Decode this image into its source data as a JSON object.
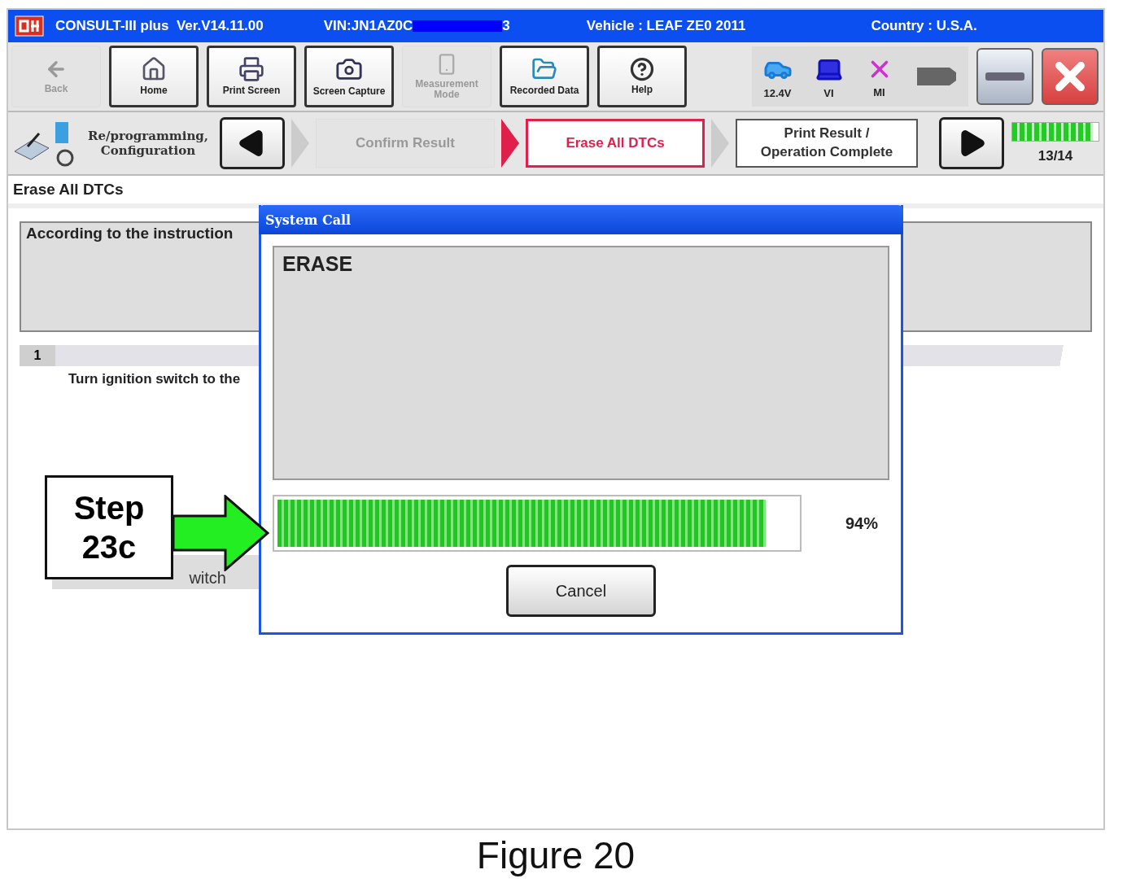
{
  "window": {
    "title": "CONSULT-III plus  Ver.V14.11.00",
    "vin_prefix": "VIN:JN1AZ0C",
    "vin_suffix": "3",
    "vehicle": "Vehicle : LEAF ZE0 2011",
    "country": "Country : U.S.A."
  },
  "toolbar": [
    {
      "kind": "back",
      "label": "Back",
      "disabled": true
    },
    {
      "kind": "home",
      "label": "Home",
      "disabled": false
    },
    {
      "kind": "print",
      "label": "Print Screen",
      "disabled": false
    },
    {
      "kind": "camera",
      "label": "Screen Capture",
      "disabled": false
    },
    {
      "kind": "measure",
      "label": "Measurement Mode",
      "disabled": true
    },
    {
      "kind": "recorded",
      "label": "Recorded Data",
      "disabled": false
    },
    {
      "kind": "help",
      "label": "Help",
      "disabled": false
    }
  ],
  "status_icons": [
    {
      "kind": "car",
      "label": "12.4V"
    },
    {
      "kind": "vi",
      "label": "VI"
    },
    {
      "kind": "mi",
      "label": "MI"
    },
    {
      "kind": "connector"
    }
  ],
  "nav": {
    "mode_label": "Re/programming, Configuration",
    "steps": [
      {
        "label": "Confirm Result",
        "selected": false,
        "disabled": true
      },
      {
        "label": "Erase All DTCs",
        "selected": true,
        "disabled": false
      },
      {
        "label": "Print Result / Operation Complete",
        "selected": false,
        "disabled": false
      }
    ],
    "progress": {
      "level": 0.93,
      "text": "13/14"
    }
  },
  "section_title": "Erase All DTCs",
  "instruction": "According to the instruction",
  "step": {
    "number": "1",
    "text": "Turn ignition switch to the",
    "text_2": "witch"
  },
  "dialog": {
    "title": "System Call",
    "message": "ERASE",
    "progress": {
      "level": 0.94,
      "reading": "94%"
    },
    "buttons": [
      "Cancel"
    ]
  },
  "callout": {
    "text": "Step 23c"
  },
  "caption": "Figure 20"
}
